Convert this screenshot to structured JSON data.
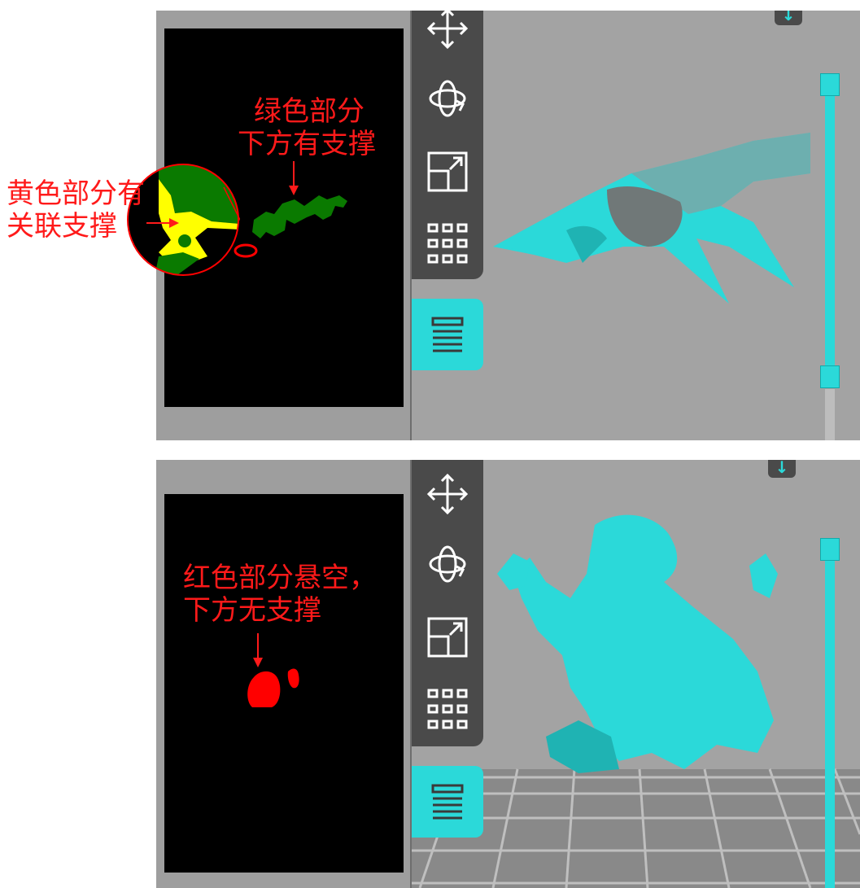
{
  "annotations": {
    "green": {
      "line1": "绿色部分",
      "line2": "下方有支撑"
    },
    "yellow": {
      "line1": "黄色部分有",
      "line2": "关联支撑"
    },
    "red": {
      "line1": "红色部分悬空，",
      "line2": "下方无支撑"
    }
  },
  "toolbar": {
    "items": [
      "move-icon",
      "rotate-icon",
      "scale-icon",
      "arrange-icon"
    ],
    "active": "layers-icon"
  },
  "colors": {
    "accent": "#2bd9d9",
    "supported": "#0a7a00",
    "linked": "#ffff00",
    "unsupported": "#ff0000",
    "annotation": "#ff1a1a"
  },
  "top_badge_icon": "download-arrow-icon",
  "top_badge_glyph": "↓"
}
